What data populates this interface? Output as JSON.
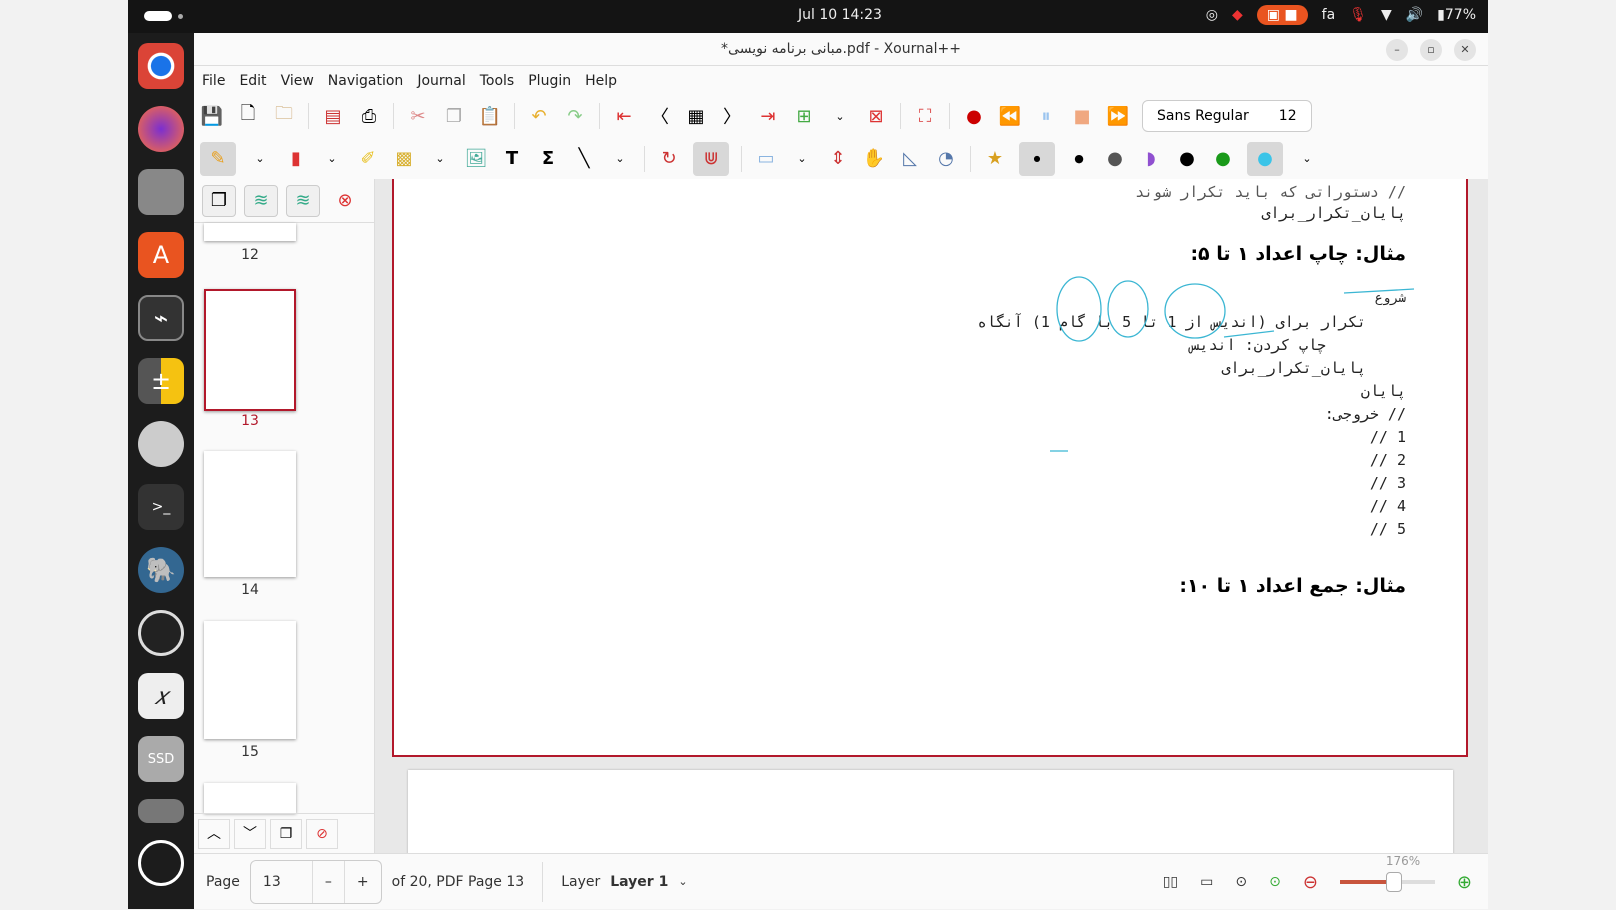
{
  "topbar": {
    "clock": "Jul 10  14:23",
    "lang": "fa",
    "battery": "77%"
  },
  "window": {
    "title": "*مبانی برنامه نویسی.pdf - Xournal++"
  },
  "menu": [
    "File",
    "Edit",
    "View",
    "Navigation",
    "Journal",
    "Tools",
    "Plugin",
    "Help"
  ],
  "toolbar": {
    "font_name": "Sans Regular",
    "font_size": "12"
  },
  "sidebar": {
    "pages": [
      "12",
      "13",
      "14",
      "15"
    ],
    "selected": "13"
  },
  "document": {
    "lines": {
      "top_partial": "// دستوراتی که باید تکرار شوند",
      "end_loop_top": "پایان_تکرار_برای",
      "heading1": "مثال: چاپ اعداد ۱ تا ۵:",
      "start": "شروع",
      "loop": "تکرار برای (اندیس از 1 تا 5 با گام 1) آنگاه",
      "print": "چاپ کردن: اندیس",
      "end_loop": "پایان_تکرار_برای",
      "end": "پایان",
      "output": "// خروجی:",
      "out": [
        "// 1",
        "// 2",
        "// 3",
        "// 4",
        "// 5"
      ],
      "heading2": "مثال: جمع اعداد ۱ تا ۱۰:"
    }
  },
  "status": {
    "page_label": "Page",
    "page_value": "13",
    "minus": "–",
    "plus": "+",
    "of": "of 20, PDF Page 13",
    "layer_label": "Layer",
    "layer_value": "Layer 1",
    "zoom": "176%",
    "zoom_fraction": 0.55
  },
  "colors": {
    "accent": "#b2182b",
    "annotation": "#3bb6d3"
  }
}
